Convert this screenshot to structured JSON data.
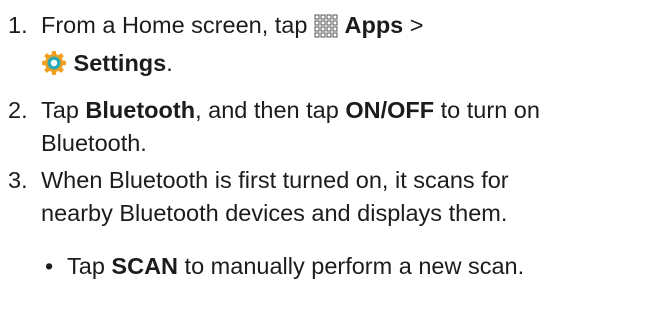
{
  "steps": [
    {
      "number": "1.",
      "pre": "From a Home screen, tap",
      "apps_icon": "apps-grid-icon",
      "apps_label": "Apps",
      "separator": ">",
      "settings_icon": "settings-gear-icon",
      "settings_label": "Settings",
      "end": "."
    },
    {
      "number": "2.",
      "t1": "Tap ",
      "b1": "Bluetooth",
      "t2": ", and then tap ",
      "b2": "ON/OFF",
      "t3": " to turn on",
      "line2": "Bluetooth."
    },
    {
      "number": "3.",
      "line1": "When Bluetooth is first turned on, it scans for",
      "line2": "nearby Bluetooth devices and displays them."
    }
  ],
  "bullet": {
    "mark": "•",
    "t1": "Tap ",
    "b1": "SCAN",
    "t2": " to manually perform a new scan."
  },
  "colors": {
    "text": "#1c1c1c",
    "icon_orange": "#f0a01e",
    "icon_teal": "#2aa9b5"
  }
}
